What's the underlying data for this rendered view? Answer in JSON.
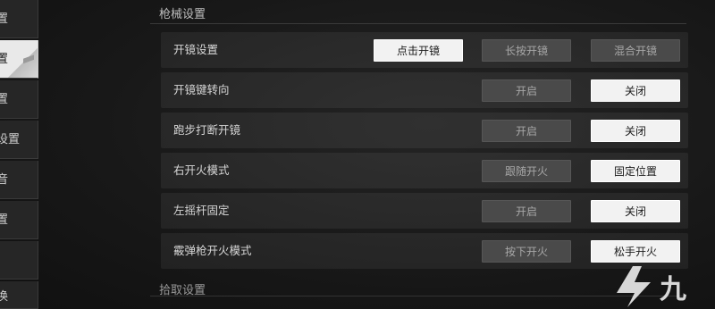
{
  "sidebar": {
    "items": [
      {
        "label": "置",
        "active": false
      },
      {
        "label": "置",
        "active": true
      },
      {
        "label": "置",
        "active": false
      },
      {
        "label": "设置",
        "active": false
      },
      {
        "label": "音",
        "active": false
      },
      {
        "label": "置",
        "active": false
      },
      {
        "label": "",
        "active": false
      },
      {
        "label": "换",
        "active": false
      }
    ]
  },
  "section": {
    "title": "枪械设置",
    "next_title": "拾取设置"
  },
  "rows": [
    {
      "label": "开镜设置",
      "options": [
        "点击开镜",
        "长按开镜",
        "混合开镜"
      ],
      "selected": 0
    },
    {
      "label": "开镜键转向",
      "options": [
        "",
        "开启",
        "关闭"
      ],
      "selected": 2
    },
    {
      "label": "跑步打断开镜",
      "options": [
        "",
        "开启",
        "关闭"
      ],
      "selected": 2
    },
    {
      "label": "右开火模式",
      "options": [
        "",
        "跟随开火",
        "固定位置"
      ],
      "selected": 2
    },
    {
      "label": "左摇杆固定",
      "options": [
        "",
        "开启",
        "关闭"
      ],
      "selected": 2
    },
    {
      "label": "霰弹枪开火模式",
      "options": [
        "",
        "按下开火",
        "松手开火"
      ],
      "selected": 2
    }
  ],
  "colors": {
    "selected_bg": "#f2f2f2",
    "unselected_bg": "#4a4a4a",
    "row_bg": "#272727",
    "background": "#161616"
  },
  "watermark": {
    "icon": "brand-logo-icon",
    "text": "九"
  }
}
